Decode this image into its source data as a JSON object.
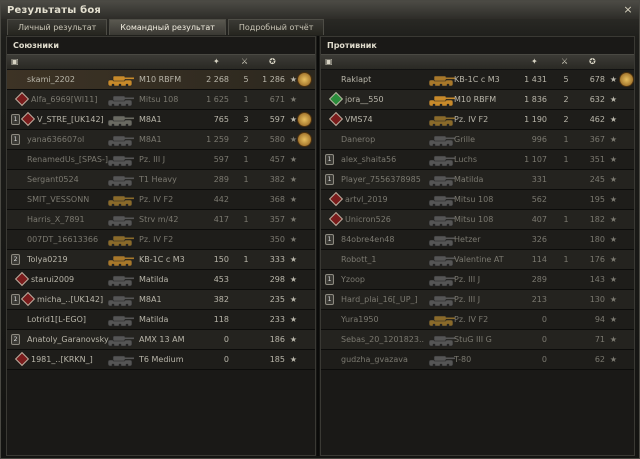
{
  "window": {
    "title": "Результаты боя",
    "close": "×"
  },
  "tabs": [
    {
      "label": "Личный результат",
      "active": false
    },
    {
      "label": "Командный результат",
      "active": true
    },
    {
      "label": "Подробный отчёт",
      "active": false
    }
  ],
  "allies": {
    "title": "Союзники",
    "rows": [
      {
        "nick": "skami_2202",
        "vehicle": "M10 RBFM",
        "damage": "2 268",
        "frags": "5",
        "xp": "1 286",
        "platoon": "",
        "badge": "",
        "medal": true,
        "me": true,
        "dead": false,
        "tank_color": "#c88a2a"
      },
      {
        "nick": "Alfa_6969[WI11]",
        "vehicle": "Mitsu 108",
        "damage": "1 625",
        "frags": "1",
        "xp": "671",
        "platoon": "",
        "badge": "red",
        "medal": false,
        "me": false,
        "dead": true,
        "tank_color": "#555"
      },
      {
        "nick": "V_STRE_[UK142]",
        "vehicle": "M8A1",
        "damage": "765",
        "frags": "3",
        "xp": "597",
        "platoon": "1",
        "badge": "red",
        "medal": true,
        "me": false,
        "dead": false,
        "tank_color": "#6a6a62"
      },
      {
        "nick": "yana636607ol",
        "vehicle": "M8A1",
        "damage": "1 259",
        "frags": "2",
        "xp": "580",
        "platoon": "1",
        "badge": "",
        "medal": true,
        "me": false,
        "dead": true,
        "tank_color": "#555"
      },
      {
        "nick": "RenamedUs_[SPAS-]",
        "vehicle": "Pz. III J",
        "damage": "597",
        "frags": "1",
        "xp": "457",
        "platoon": "",
        "badge": "",
        "medal": false,
        "me": false,
        "dead": true,
        "tank_color": "#555"
      },
      {
        "nick": "Sergant0524",
        "vehicle": "T1 Heavy",
        "damage": "289",
        "frags": "1",
        "xp": "382",
        "platoon": "",
        "badge": "",
        "medal": false,
        "me": false,
        "dead": true,
        "tank_color": "#555"
      },
      {
        "nick": "SMIT_VESSONN",
        "vehicle": "Pz. IV F2",
        "damage": "442",
        "frags": "",
        "xp": "368",
        "platoon": "",
        "badge": "",
        "medal": false,
        "me": false,
        "dead": true,
        "tank_color": "#8a6a2a"
      },
      {
        "nick": "Harris_X_7891",
        "vehicle": "Strv m/42",
        "damage": "417",
        "frags": "1",
        "xp": "357",
        "platoon": "",
        "badge": "",
        "medal": false,
        "me": false,
        "dead": true,
        "tank_color": "#555"
      },
      {
        "nick": "007DT_16613366",
        "vehicle": "Pz. IV F2",
        "damage": "",
        "frags": "",
        "xp": "350",
        "platoon": "",
        "badge": "",
        "medal": false,
        "me": false,
        "dead": true,
        "tank_color": "#8a6a2a"
      },
      {
        "nick": "Tolya0219",
        "vehicle": "KB-1C c M3",
        "damage": "150",
        "frags": "1",
        "xp": "333",
        "platoon": "2",
        "badge": "",
        "medal": false,
        "me": false,
        "dead": false,
        "tank_color": "#a8782a"
      },
      {
        "nick": "starui2009",
        "vehicle": "Matilda",
        "damage": "453",
        "frags": "",
        "xp": "298",
        "platoon": "",
        "badge": "red",
        "medal": false,
        "me": false,
        "dead": false,
        "tank_color": "#555"
      },
      {
        "nick": "micha_..[UK142]",
        "vehicle": "M8A1",
        "damage": "382",
        "frags": "",
        "xp": "235",
        "platoon": "1",
        "badge": "red",
        "medal": false,
        "me": false,
        "dead": false,
        "tank_color": "#555"
      },
      {
        "nick": "Lotrid1[L-EGO]",
        "vehicle": "Matilda",
        "damage": "118",
        "frags": "",
        "xp": "233",
        "platoon": "",
        "badge": "",
        "medal": false,
        "me": false,
        "dead": false,
        "tank_color": "#555"
      },
      {
        "nick": "Anatoly_Garanovsky",
        "vehicle": "AMX 13 AM",
        "damage": "0",
        "frags": "",
        "xp": "186",
        "platoon": "2",
        "badge": "",
        "medal": false,
        "me": false,
        "dead": false,
        "tank_color": "#555"
      },
      {
        "nick": "1981_..[KRKN_]",
        "vehicle": "T6 Medium",
        "damage": "0",
        "frags": "",
        "xp": "185",
        "platoon": "",
        "badge": "red",
        "medal": false,
        "me": false,
        "dead": false,
        "tank_color": "#555"
      }
    ]
  },
  "enemies": {
    "title": "Противник",
    "rows": [
      {
        "nick": "Raklapt",
        "vehicle": "KB-1C c M3",
        "damage": "1 431",
        "frags": "5",
        "xp": "678",
        "platoon": "",
        "badge": "",
        "medal": true,
        "me": false,
        "dead": false,
        "tank_color": "#a8782a"
      },
      {
        "nick": "jora__550",
        "vehicle": "M10 RBFM",
        "damage": "1 836",
        "frags": "2",
        "xp": "632",
        "platoon": "",
        "badge": "green",
        "medal": false,
        "me": false,
        "dead": false,
        "tank_color": "#c88a2a"
      },
      {
        "nick": "VMS74",
        "vehicle": "Pz. IV F2",
        "damage": "1 190",
        "frags": "2",
        "xp": "462",
        "platoon": "",
        "badge": "red",
        "medal": false,
        "me": false,
        "dead": false,
        "tank_color": "#8a6a2a"
      },
      {
        "nick": "Danerop",
        "vehicle": "Grille",
        "damage": "996",
        "frags": "1",
        "xp": "367",
        "platoon": "",
        "badge": "",
        "medal": false,
        "me": false,
        "dead": true,
        "tank_color": "#555"
      },
      {
        "nick": "alex_shaita56",
        "vehicle": "Luchs",
        "damage": "1 107",
        "frags": "1",
        "xp": "351",
        "platoon": "1",
        "badge": "",
        "medal": false,
        "me": false,
        "dead": true,
        "tank_color": "#555"
      },
      {
        "nick": "Player_7556378985",
        "vehicle": "Matilda",
        "damage": "331",
        "frags": "",
        "xp": "245",
        "platoon": "1",
        "badge": "",
        "medal": false,
        "me": false,
        "dead": true,
        "tank_color": "#555"
      },
      {
        "nick": "artvl_2019",
        "vehicle": "Mitsu 108",
        "damage": "562",
        "frags": "",
        "xp": "195",
        "platoon": "",
        "badge": "red",
        "medal": false,
        "me": false,
        "dead": true,
        "tank_color": "#555"
      },
      {
        "nick": "Unicron526",
        "vehicle": "Mitsu 108",
        "damage": "407",
        "frags": "1",
        "xp": "182",
        "platoon": "",
        "badge": "red",
        "medal": false,
        "me": false,
        "dead": true,
        "tank_color": "#555"
      },
      {
        "nick": "84obre4en48",
        "vehicle": "Hetzer",
        "damage": "326",
        "frags": "",
        "xp": "180",
        "platoon": "1",
        "badge": "",
        "medal": false,
        "me": false,
        "dead": true,
        "tank_color": "#555"
      },
      {
        "nick": "Robott_1",
        "vehicle": "Valentine AT",
        "damage": "114",
        "frags": "1",
        "xp": "176",
        "platoon": "",
        "badge": "",
        "medal": false,
        "me": false,
        "dead": true,
        "tank_color": "#555"
      },
      {
        "nick": "Yzoop",
        "vehicle": "Pz. III J",
        "damage": "289",
        "frags": "",
        "xp": "143",
        "platoon": "1",
        "badge": "",
        "medal": false,
        "me": false,
        "dead": true,
        "tank_color": "#555"
      },
      {
        "nick": "Hard_plai_16[_UP_]",
        "vehicle": "Pz. III J",
        "damage": "213",
        "frags": "",
        "xp": "130",
        "platoon": "1",
        "badge": "",
        "medal": false,
        "me": false,
        "dead": true,
        "tank_color": "#555"
      },
      {
        "nick": "Yura1950",
        "vehicle": "Pz. IV F2",
        "damage": "0",
        "frags": "",
        "xp": "94",
        "platoon": "",
        "badge": "",
        "medal": false,
        "me": false,
        "dead": true,
        "tank_color": "#8a6a2a"
      },
      {
        "nick": "Sebas_20_1201823..",
        "vehicle": "StuG III G",
        "damage": "0",
        "frags": "",
        "xp": "71",
        "platoon": "",
        "badge": "",
        "medal": false,
        "me": false,
        "dead": true,
        "tank_color": "#555"
      },
      {
        "nick": "gudzha_gvazava",
        "vehicle": "T-80",
        "damage": "0",
        "frags": "",
        "xp": "62",
        "platoon": "",
        "badge": "",
        "medal": false,
        "me": false,
        "dead": true,
        "tank_color": "#555"
      }
    ]
  },
  "icons": {
    "star": "★",
    "platoon": "squad-icon",
    "damage": "damage-icon",
    "frags": "frags-icon",
    "xp": "xp-icon"
  }
}
